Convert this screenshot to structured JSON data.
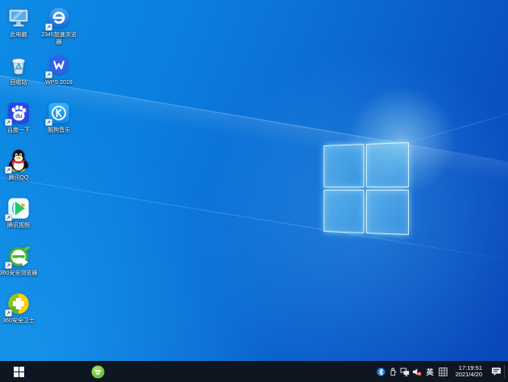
{
  "desktop": {
    "items": [
      {
        "label": "此电脑",
        "icon": "computer-icon",
        "shortcut": false
      },
      {
        "label": "2345加速浏览器",
        "icon": "2345-browser-icon",
        "shortcut": true
      },
      {
        "label": "回收站",
        "icon": "recycle-bin-icon",
        "shortcut": false
      },
      {
        "label": "WPS 2019",
        "icon": "wps-icon",
        "shortcut": true
      },
      {
        "label": "百度一下",
        "icon": "baidu-icon",
        "shortcut": true
      },
      {
        "label": "酷狗音乐",
        "icon": "kugou-music-icon",
        "shortcut": true
      },
      {
        "label": "腾讯QQ",
        "icon": "qq-penguin-icon",
        "shortcut": true
      },
      {
        "label": "腾讯视频",
        "icon": "tencent-video-icon",
        "shortcut": true
      },
      {
        "label": "360安全浏览器",
        "icon": "360-browser-icon",
        "shortcut": true
      },
      {
        "label": "360安全卫士",
        "icon": "360-safe-icon",
        "shortcut": true
      }
    ]
  },
  "wallpaper": {
    "style": "windows10-light-rays",
    "base_color": "#0b6ad2",
    "highlight_color": "#9fe4ff"
  },
  "taskbar": {
    "background_color": "#0d1621",
    "start_icon": "windows-start-icon",
    "apps": [
      {
        "icon": "green-360-app-icon"
      }
    ],
    "tray": {
      "icons": [
        "bluetooth-icon",
        "usb-device-icon",
        "network-display-icon",
        "volume-muted-icon",
        "ime-keyboard-icon",
        "action-center-icon"
      ],
      "ime_mode": "英",
      "clock": {
        "time": "17:19:51",
        "date": "2021/4/20"
      }
    }
  }
}
